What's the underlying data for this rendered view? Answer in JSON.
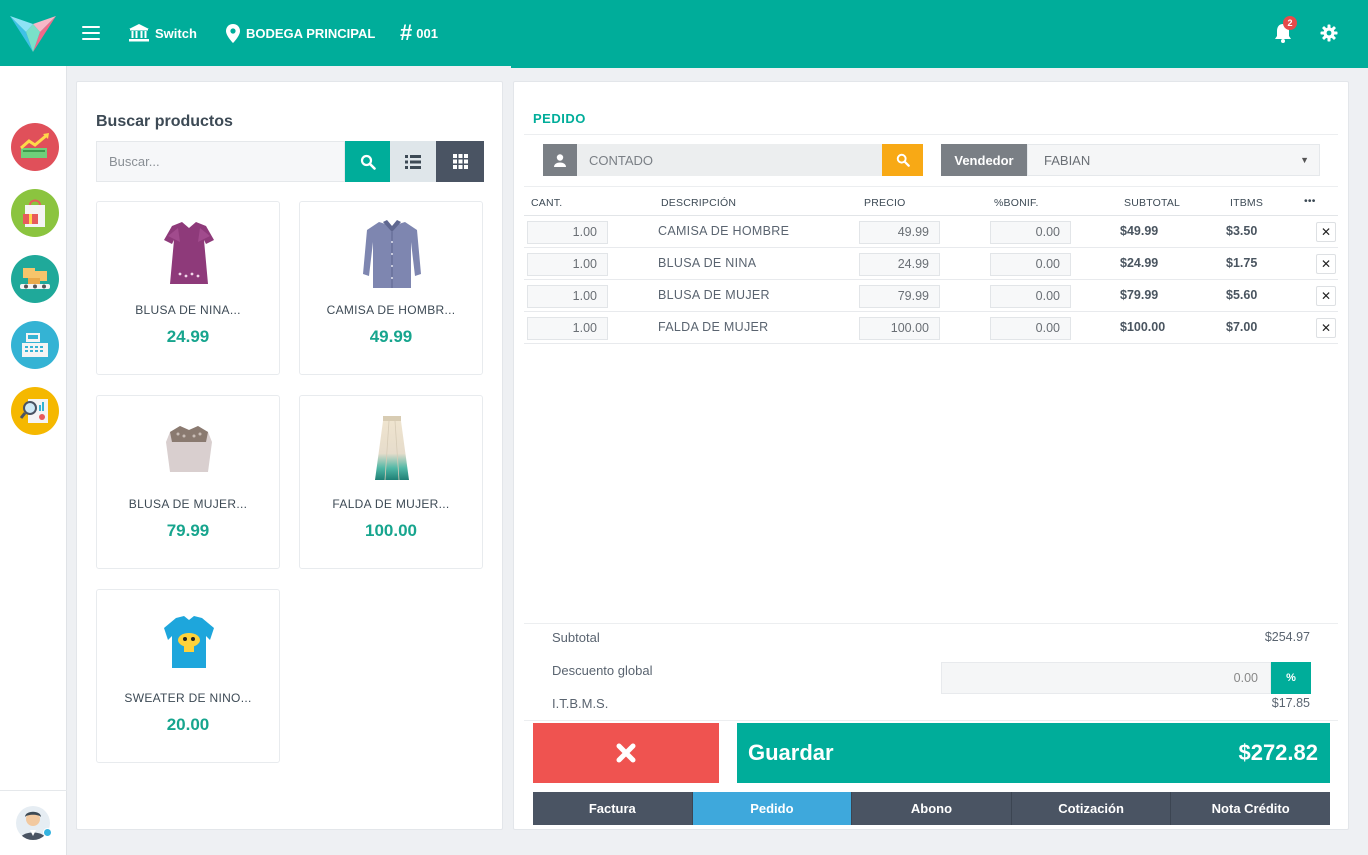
{
  "topbar": {
    "switch_label": "Switch",
    "location_label": "BODEGA PRINCIPAL",
    "register_label": "001",
    "notification_count": "2"
  },
  "colors": {
    "brand": "#00ad9a",
    "danger": "#ef5350",
    "warning": "#f8a915",
    "dark": "#4a5463",
    "active_tab": "#3ea8dc"
  },
  "sidebar": {
    "items": [
      {
        "icon": "sales-chart-icon"
      },
      {
        "icon": "shopping-bag-icon"
      },
      {
        "icon": "conveyor-boxes-icon"
      },
      {
        "icon": "cash-register-icon"
      },
      {
        "icon": "report-magnifier-icon"
      }
    ],
    "avatar_icon": "user-avatar-icon"
  },
  "products": {
    "title": "Buscar productos",
    "search_placeholder": "Buscar...",
    "items": [
      {
        "name": "BLUSA DE NINA...",
        "price": "24.99",
        "icon": "girl-blouse-image"
      },
      {
        "name": "CAMISA DE HOMBR...",
        "price": "49.99",
        "icon": "men-shirt-image"
      },
      {
        "name": "BLUSA DE MUJER...",
        "price": "79.99",
        "icon": "women-blouse-image"
      },
      {
        "name": "FALDA DE MUJER...",
        "price": "100.00",
        "icon": "women-skirt-image"
      },
      {
        "name": "SWEATER DE NINO...",
        "price": "20.00",
        "icon": "kids-sweater-image"
      }
    ]
  },
  "order": {
    "title": "PEDIDO",
    "customer_value": "CONTADO",
    "seller_label": "Vendedor",
    "seller_value": "FABIAN",
    "columns": [
      "CANT.",
      "DESCRIPCIÓN",
      "PRECIO",
      "%BONIF.",
      "SUBTOTAL",
      "ITBMS",
      "•••"
    ],
    "rows": [
      {
        "qty": "1.00",
        "desc": "CAMISA DE HOMBRE",
        "price": "49.99",
        "bonif": "0.00",
        "subtotal": "$49.99",
        "itbms": "$3.50"
      },
      {
        "qty": "1.00",
        "desc": "BLUSA DE NINA",
        "price": "24.99",
        "bonif": "0.00",
        "subtotal": "$24.99",
        "itbms": "$1.75"
      },
      {
        "qty": "1.00",
        "desc": "BLUSA DE MUJER",
        "price": "79.99",
        "bonif": "0.00",
        "subtotal": "$79.99",
        "itbms": "$5.60"
      },
      {
        "qty": "1.00",
        "desc": "FALDA DE MUJER",
        "price": "100.00",
        "bonif": "0.00",
        "subtotal": "$100.00",
        "itbms": "$7.00"
      }
    ],
    "subtotal_label": "Subtotal",
    "subtotal_value": "$254.97",
    "discount_label": "Descuento global",
    "discount_value": "0.00",
    "discount_btn": "%",
    "itbms_label": "I.T.B.M.S.",
    "itbms_value": "$17.85",
    "save_label": "Guardar",
    "total": "$272.82",
    "doc_tabs": [
      {
        "label": "Factura",
        "active": false
      },
      {
        "label": "Pedido",
        "active": true
      },
      {
        "label": "Abono",
        "active": false
      },
      {
        "label": "Cotización",
        "active": false
      },
      {
        "label": "Nota Crédito",
        "active": false
      }
    ]
  }
}
